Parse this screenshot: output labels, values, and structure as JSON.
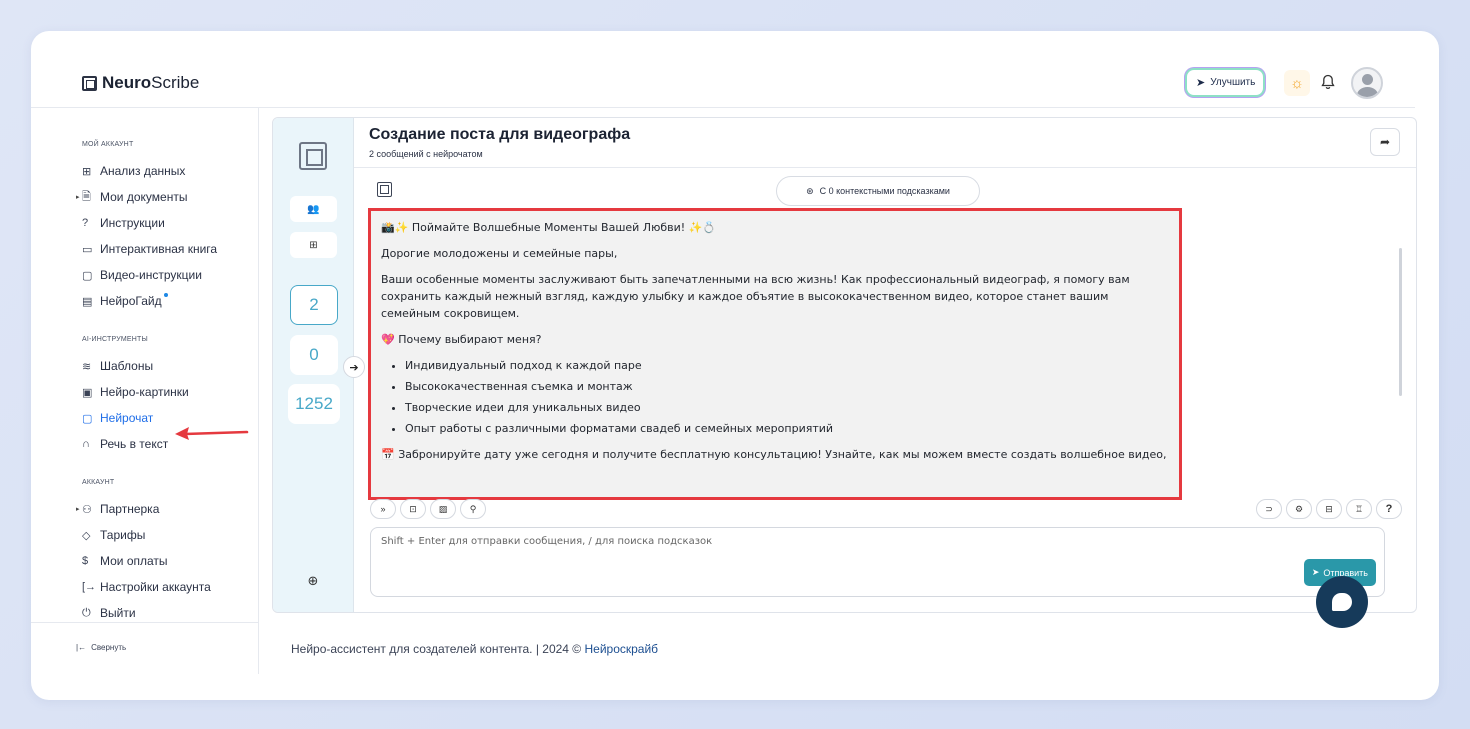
{
  "app": {
    "brand_bold": "Neuro",
    "brand_rest": "Scribe"
  },
  "header": {
    "upgrade_label": "Улучшить",
    "upgrade_icon": "rocket-icon",
    "theme_icon": "sun-icon",
    "bell_icon": "bell-icon",
    "avatar_icon": "user-avatar"
  },
  "sidebar": {
    "sections": [
      {
        "title": "МОЙ АККАУНТ"
      },
      {
        "title": "AI-ИНСТРУМЕНТЫ"
      },
      {
        "title": "АККАУНТ"
      }
    ],
    "items": [
      {
        "label": "Анализ данных",
        "icon": "grid-icon"
      },
      {
        "label": "Мои документы",
        "icon": "document-icon"
      },
      {
        "label": "Инструкции",
        "icon": "question-icon"
      },
      {
        "label": "Интерактивная книга",
        "icon": "book-icon"
      },
      {
        "label": "Видео-инструкции",
        "icon": "video-icon"
      },
      {
        "label": "НейроГайд",
        "icon": "guide-icon"
      },
      {
        "label": "Шаблоны",
        "icon": "layers-icon"
      },
      {
        "label": "Нейро-картинки",
        "icon": "image-icon"
      },
      {
        "label": "Нейрочат",
        "icon": "chat-icon"
      },
      {
        "label": "Речь в текст",
        "icon": "headphones-icon"
      },
      {
        "label": "Партнерка",
        "icon": "users-icon"
      },
      {
        "label": "Тарифы",
        "icon": "tag-icon"
      },
      {
        "label": "Мои оплаты",
        "icon": "dollar-icon"
      },
      {
        "label": "Настройки аккаунта",
        "icon": "settings-login-icon"
      },
      {
        "label": "Выйти",
        "icon": "power-icon"
      }
    ],
    "active_item": "Нейрочат",
    "collapse_label": "Свернуть"
  },
  "strip": {
    "count_messages": "2",
    "count_zero": "0",
    "count_tokens": "1252"
  },
  "chat": {
    "title": "Создание поста для видеографа",
    "subtitle": "2 сообщений с нейрочатом",
    "context_pill": "С 0 контекстными подсказками",
    "message": {
      "heading": "📸✨ Поймайте Волшебные Моменты Вашей Любви! ✨💍",
      "greeting": "Дорогие молодожены и семейные пары,",
      "paragraph": "Ваши особенные моменты заслуживают быть запечатленными на всю жизнь! Как профессиональный видеограф, я помогу вам сохранить каждый нежный взгляд, каждую улыбку и каждое объятие в высококачественном видео, которое станет вашим семейным сокровищем.",
      "why_heading": "💖 Почему выбирают меня?",
      "bullets": [
        "Индивидуальный подход к каждой паре",
        "Высококачественная съемка и монтаж",
        "Творческие идеи для уникальных видео",
        "Опыт работы с различными форматами свадеб и семейных мероприятий"
      ],
      "cta": "📅 Забронируйте дату уже сегодня и получите бесплатную консультацию! Узнайте, как мы можем вместе создать волшебное видео,"
    },
    "input_placeholder": "Shift + Enter для отправки сообщения, / для поиска подсказок",
    "send_label": "Отправить"
  },
  "footer": {
    "text": "Нейро-ассистент для создателей контента.  | 2024 © ",
    "link": "Нейроскрайб"
  },
  "colors": {
    "accent": "#2a98a9",
    "highlight_border": "#e5393f",
    "active_nav": "#1f6ee8",
    "count_color": "#48a8c8"
  }
}
